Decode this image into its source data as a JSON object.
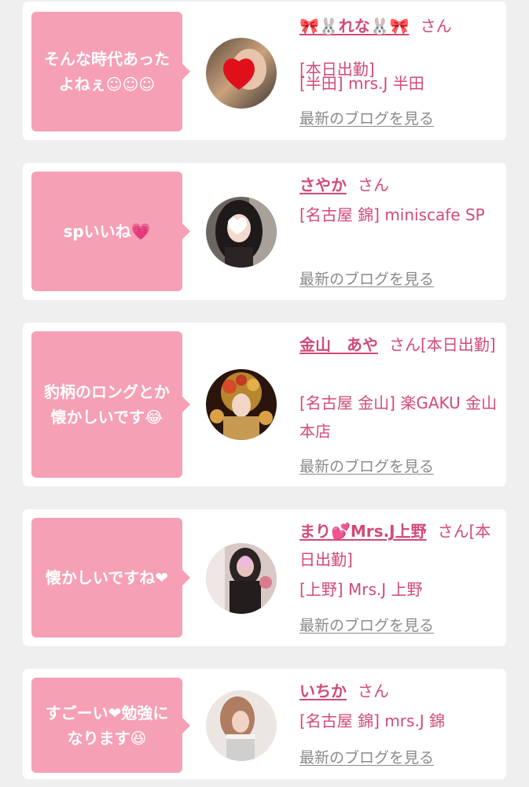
{
  "colors": {
    "background": "#efefef",
    "bubble": "#f6a0b5",
    "accent": "#d24a75",
    "link": "#8a8a8a"
  },
  "blog_link_label": "最新のブログを見る",
  "honorific": "さん",
  "posts": [
    {
      "message": "そんな時代あった\nよねぇ☺☺☺",
      "name": "🎀🐰れな🐰🎀",
      "status": "[本日出勤]",
      "shop": "[半田] mrs.J 半田"
    },
    {
      "message": "spいいね💗",
      "name": "さやか",
      "status": "",
      "shop": "[名古屋 錦] miniscafe SP"
    },
    {
      "message": "豹柄のロングとか\n懐かしいです😂",
      "name": "金山　あや",
      "status": "[本日出勤]",
      "shop": "[名古屋 金山] 楽GAKU 金山本店"
    },
    {
      "message": "懐かしいですね❤",
      "name": "まり💕Mrs.J上野",
      "status": "[本日出勤]",
      "shop": "[上野] Mrs.J 上野"
    },
    {
      "message": "すごーい❤勉強に\nなります😆",
      "name": "いちか",
      "status": "",
      "shop": "[名古屋 錦] mrs.J 錦"
    }
  ]
}
